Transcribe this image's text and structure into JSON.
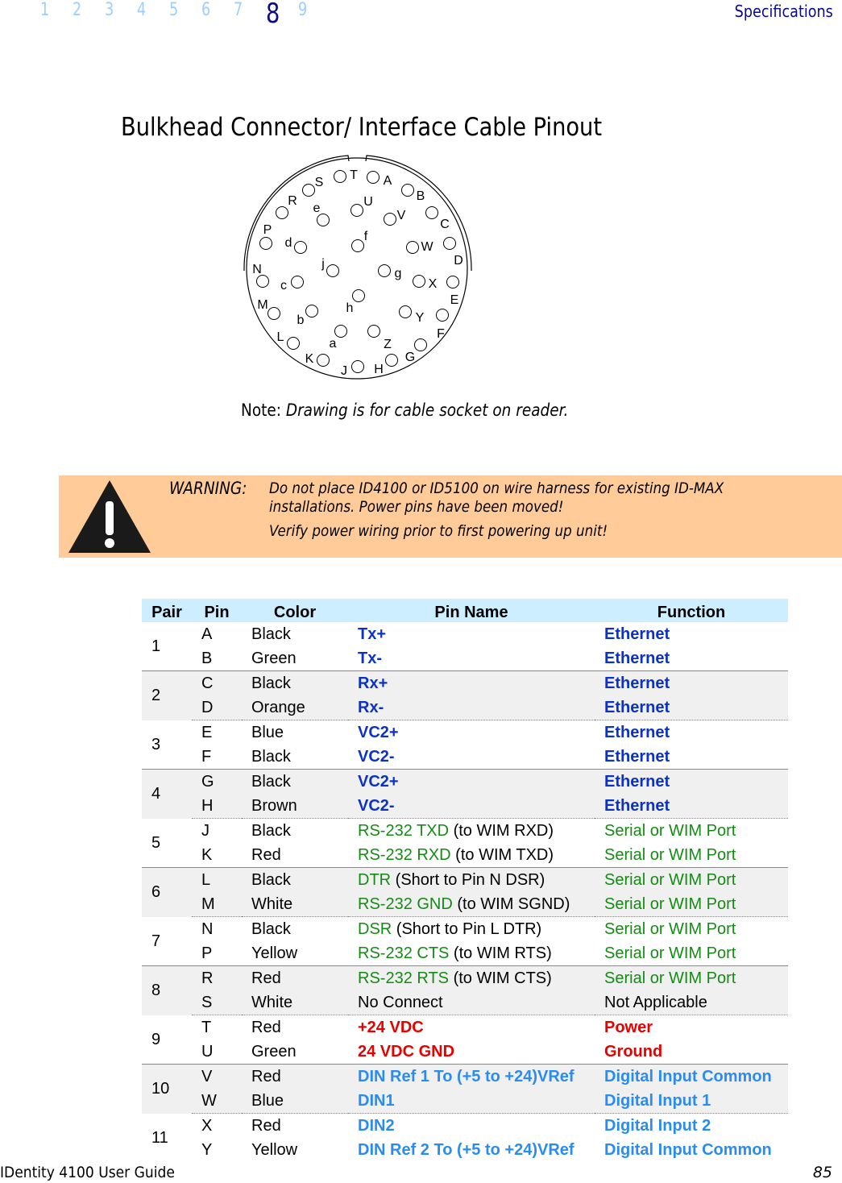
{
  "nav": {
    "pages": [
      "1",
      "2",
      "3",
      "4",
      "5",
      "6",
      "7",
      "8",
      "9"
    ],
    "current": "8",
    "section": "Specifications"
  },
  "title": "Bulkhead Connector/ Interface Cable Pinout",
  "connector": {
    "pins": [
      "T",
      "A",
      "S",
      "B",
      "R",
      "e",
      "U",
      "V",
      "C",
      "P",
      "d",
      "f",
      "W",
      "D",
      "N",
      "c",
      "j",
      "g",
      "X",
      "E",
      "M",
      "b",
      "h",
      "Y",
      "F",
      "L",
      "a",
      "Z",
      "G",
      "K",
      "J",
      "H"
    ]
  },
  "note": {
    "label": "Note:",
    "text": " Drawing is for cable socket on reader."
  },
  "warning": {
    "label": "WARNING:",
    "lines": [
      "Do not place ID4100 or ID5100 on wire harness for existing ID-MAX",
      "installations. Power pins have been moved!",
      "Verify power wiring prior to first powering up unit!"
    ]
  },
  "table": {
    "headers": [
      "Pair",
      "Pin",
      "Color",
      "Pin Name",
      "Function"
    ],
    "rows": [
      {
        "pair": "1",
        "pin": "A",
        "color": "Black",
        "name": "Tx+",
        "suffix": "",
        "func": "Ethernet",
        "style": "blue"
      },
      {
        "pin": "B",
        "color": "Green",
        "name": "Tx-",
        "suffix": "",
        "func": "Ethernet",
        "style": "blue"
      },
      {
        "pair": "2",
        "pin": "C",
        "color": "Black",
        "name": "Rx+",
        "suffix": "",
        "func": "Ethernet",
        "style": "blue"
      },
      {
        "pin": "D",
        "color": "Orange",
        "name": "Rx-",
        "suffix": "",
        "func": "Ethernet",
        "style": "blue"
      },
      {
        "pair": "3",
        "pin": "E",
        "color": "Blue",
        "name": "VC2+",
        "suffix": "",
        "func": "Ethernet",
        "style": "blue"
      },
      {
        "pin": "F",
        "color": "Black",
        "name": "VC2-",
        "suffix": "",
        "func": "Ethernet",
        "style": "blue"
      },
      {
        "pair": "4",
        "pin": "G",
        "color": "Black",
        "name": "VC2+",
        "suffix": "",
        "func": "Ethernet",
        "style": "blue"
      },
      {
        "pin": "H",
        "color": "Brown",
        "name": "VC2-",
        "suffix": "",
        "func": "Ethernet",
        "style": "blue"
      },
      {
        "pair": "5",
        "pin": "J",
        "color": "Black",
        "name": "RS-232 TXD",
        "suffix": " (to WIM RXD)",
        "func": "Serial or WIM Port",
        "style": "green"
      },
      {
        "pin": "K",
        "color": "Red",
        "name": "RS-232 RXD",
        "suffix": " (to WIM TXD)",
        "func": "Serial or WIM Port",
        "style": "green"
      },
      {
        "pair": "6",
        "pin": "L",
        "color": "Black",
        "name": "DTR",
        "suffix": " (Short to Pin N DSR)",
        "func": "Serial or WIM Port",
        "style": "green"
      },
      {
        "pin": "M",
        "color": "White",
        "name": "RS-232 GND",
        "suffix": " (to WIM SGND)",
        "func": "Serial or WIM Port",
        "style": "green"
      },
      {
        "pair": "7",
        "pin": "N",
        "color": "Black",
        "name": "DSR",
        "suffix": " (Short to Pin L DTR)",
        "func": "Serial or WIM Port",
        "style": "green"
      },
      {
        "pin": "P",
        "color": "Yellow",
        "name": "RS-232 CTS",
        "suffix": " (to WIM RTS)",
        "func": "Serial or WIM Port",
        "style": "green"
      },
      {
        "pair": "8",
        "pin": "R",
        "color": "Red",
        "name": "RS-232 RTS",
        "suffix": " (to WIM CTS)",
        "func": "Serial or WIM Port",
        "style": "green"
      },
      {
        "pin": "S",
        "color": "White",
        "name": "No Connect",
        "suffix": "",
        "func": "Not Applicable",
        "style": "plain"
      },
      {
        "pair": "9",
        "pin": "T",
        "color": "Red",
        "name": "+24 VDC",
        "suffix": "",
        "func": "Power",
        "style": "red"
      },
      {
        "pin": "U",
        "color": "Green",
        "name": "24 VDC GND",
        "suffix": "",
        "func": "Ground",
        "style": "red"
      },
      {
        "pair": "10",
        "pin": "V",
        "color": "Red",
        "name": "DIN Ref 1 To (+5 to +24)VRef",
        "suffix": "",
        "func": "Digital Input Common",
        "style": "lblue"
      },
      {
        "pin": "W",
        "color": "Blue",
        "name": "DIN1",
        "suffix": "",
        "func": "Digital Input 1",
        "style": "lblue"
      },
      {
        "pair": "11",
        "pin": "X",
        "color": "Red",
        "name": "DIN2",
        "suffix": "",
        "func": "Digital Input 2",
        "style": "lblue"
      },
      {
        "pin": "Y",
        "color": "Yellow",
        "name": "DIN Ref 2 To (+5 to +24)VRef",
        "suffix": "",
        "func": "Digital Input Common",
        "style": "lblue"
      }
    ]
  },
  "footer": {
    "left": "IDentity 4100 User Guide",
    "page": "85"
  }
}
